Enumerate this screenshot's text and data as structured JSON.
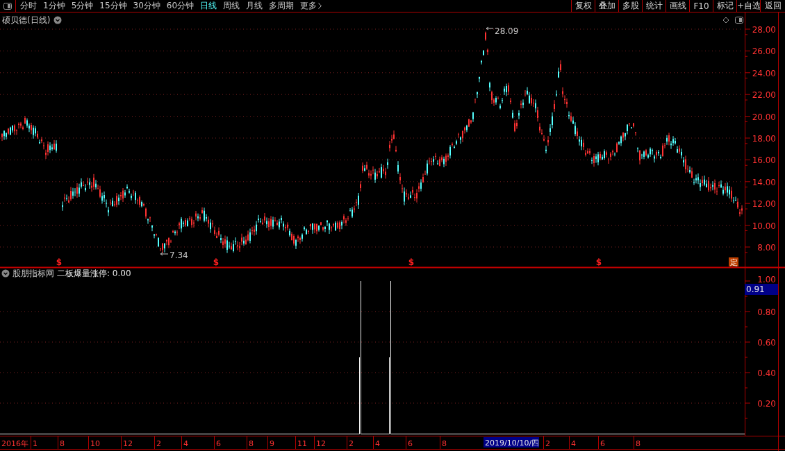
{
  "toolbar": {
    "period_tabs": [
      {
        "label": "分时",
        "selected": false
      },
      {
        "label": "1分钟",
        "selected": false
      },
      {
        "label": "5分钟",
        "selected": false
      },
      {
        "label": "15分钟",
        "selected": false
      },
      {
        "label": "30分钟",
        "selected": false
      },
      {
        "label": "60分钟",
        "selected": false
      },
      {
        "label": "日线",
        "selected": true
      },
      {
        "label": "周线",
        "selected": false
      },
      {
        "label": "月线",
        "selected": false
      },
      {
        "label": "多周期",
        "selected": false
      },
      {
        "label": "更多",
        "selected": false
      }
    ],
    "actions": [
      "复权",
      "叠加",
      "多股",
      "统计",
      "画线",
      "F10",
      "标记",
      "+自选",
      "返回"
    ]
  },
  "price_panel": {
    "title": "硕贝德(日线)",
    "axis_labels": [
      "28.00",
      "26.00",
      "24.00",
      "22.00",
      "20.00",
      "18.00",
      "16.00",
      "14.00",
      "12.00",
      "10.00",
      "8.00"
    ],
    "high_label": "28.09",
    "low_label": "7.34",
    "signal_marks": [
      "$",
      "$",
      "$",
      "$"
    ],
    "badge": "定"
  },
  "indicator_panel": {
    "source": "股朋指标网",
    "formula": "二板爆量涨停: 0.00",
    "axis_labels": [
      "1.00",
      "0.80",
      "0.60",
      "0.40",
      "0.20"
    ],
    "cursor_value": "0.91"
  },
  "date_axis": {
    "labels": [
      "2016年",
      "1",
      "8",
      "10",
      "12",
      "2",
      "4",
      "6",
      "8",
      "9",
      "11",
      "12",
      "2",
      "4",
      "6",
      "8",
      "2",
      "4",
      "6",
      "8"
    ],
    "cursor_date": "2019/10/10/四"
  }
}
